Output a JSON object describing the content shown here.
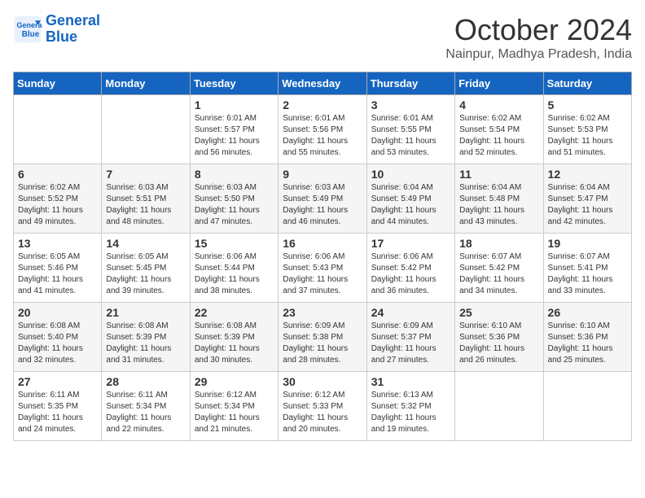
{
  "header": {
    "logo_line1": "General",
    "logo_line2": "Blue",
    "month": "October 2024",
    "location": "Nainpur, Madhya Pradesh, India"
  },
  "weekdays": [
    "Sunday",
    "Monday",
    "Tuesday",
    "Wednesday",
    "Thursday",
    "Friday",
    "Saturday"
  ],
  "weeks": [
    [
      {
        "day": "",
        "info": ""
      },
      {
        "day": "",
        "info": ""
      },
      {
        "day": "1",
        "info": "Sunrise: 6:01 AM\nSunset: 5:57 PM\nDaylight: 11 hours\nand 56 minutes."
      },
      {
        "day": "2",
        "info": "Sunrise: 6:01 AM\nSunset: 5:56 PM\nDaylight: 11 hours\nand 55 minutes."
      },
      {
        "day": "3",
        "info": "Sunrise: 6:01 AM\nSunset: 5:55 PM\nDaylight: 11 hours\nand 53 minutes."
      },
      {
        "day": "4",
        "info": "Sunrise: 6:02 AM\nSunset: 5:54 PM\nDaylight: 11 hours\nand 52 minutes."
      },
      {
        "day": "5",
        "info": "Sunrise: 6:02 AM\nSunset: 5:53 PM\nDaylight: 11 hours\nand 51 minutes."
      }
    ],
    [
      {
        "day": "6",
        "info": "Sunrise: 6:02 AM\nSunset: 5:52 PM\nDaylight: 11 hours\nand 49 minutes."
      },
      {
        "day": "7",
        "info": "Sunrise: 6:03 AM\nSunset: 5:51 PM\nDaylight: 11 hours\nand 48 minutes."
      },
      {
        "day": "8",
        "info": "Sunrise: 6:03 AM\nSunset: 5:50 PM\nDaylight: 11 hours\nand 47 minutes."
      },
      {
        "day": "9",
        "info": "Sunrise: 6:03 AM\nSunset: 5:49 PM\nDaylight: 11 hours\nand 46 minutes."
      },
      {
        "day": "10",
        "info": "Sunrise: 6:04 AM\nSunset: 5:49 PM\nDaylight: 11 hours\nand 44 minutes."
      },
      {
        "day": "11",
        "info": "Sunrise: 6:04 AM\nSunset: 5:48 PM\nDaylight: 11 hours\nand 43 minutes."
      },
      {
        "day": "12",
        "info": "Sunrise: 6:04 AM\nSunset: 5:47 PM\nDaylight: 11 hours\nand 42 minutes."
      }
    ],
    [
      {
        "day": "13",
        "info": "Sunrise: 6:05 AM\nSunset: 5:46 PM\nDaylight: 11 hours\nand 41 minutes."
      },
      {
        "day": "14",
        "info": "Sunrise: 6:05 AM\nSunset: 5:45 PM\nDaylight: 11 hours\nand 39 minutes."
      },
      {
        "day": "15",
        "info": "Sunrise: 6:06 AM\nSunset: 5:44 PM\nDaylight: 11 hours\nand 38 minutes."
      },
      {
        "day": "16",
        "info": "Sunrise: 6:06 AM\nSunset: 5:43 PM\nDaylight: 11 hours\nand 37 minutes."
      },
      {
        "day": "17",
        "info": "Sunrise: 6:06 AM\nSunset: 5:42 PM\nDaylight: 11 hours\nand 36 minutes."
      },
      {
        "day": "18",
        "info": "Sunrise: 6:07 AM\nSunset: 5:42 PM\nDaylight: 11 hours\nand 34 minutes."
      },
      {
        "day": "19",
        "info": "Sunrise: 6:07 AM\nSunset: 5:41 PM\nDaylight: 11 hours\nand 33 minutes."
      }
    ],
    [
      {
        "day": "20",
        "info": "Sunrise: 6:08 AM\nSunset: 5:40 PM\nDaylight: 11 hours\nand 32 minutes."
      },
      {
        "day": "21",
        "info": "Sunrise: 6:08 AM\nSunset: 5:39 PM\nDaylight: 11 hours\nand 31 minutes."
      },
      {
        "day": "22",
        "info": "Sunrise: 6:08 AM\nSunset: 5:39 PM\nDaylight: 11 hours\nand 30 minutes."
      },
      {
        "day": "23",
        "info": "Sunrise: 6:09 AM\nSunset: 5:38 PM\nDaylight: 11 hours\nand 28 minutes."
      },
      {
        "day": "24",
        "info": "Sunrise: 6:09 AM\nSunset: 5:37 PM\nDaylight: 11 hours\nand 27 minutes."
      },
      {
        "day": "25",
        "info": "Sunrise: 6:10 AM\nSunset: 5:36 PM\nDaylight: 11 hours\nand 26 minutes."
      },
      {
        "day": "26",
        "info": "Sunrise: 6:10 AM\nSunset: 5:36 PM\nDaylight: 11 hours\nand 25 minutes."
      }
    ],
    [
      {
        "day": "27",
        "info": "Sunrise: 6:11 AM\nSunset: 5:35 PM\nDaylight: 11 hours\nand 24 minutes."
      },
      {
        "day": "28",
        "info": "Sunrise: 6:11 AM\nSunset: 5:34 PM\nDaylight: 11 hours\nand 22 minutes."
      },
      {
        "day": "29",
        "info": "Sunrise: 6:12 AM\nSunset: 5:34 PM\nDaylight: 11 hours\nand 21 minutes."
      },
      {
        "day": "30",
        "info": "Sunrise: 6:12 AM\nSunset: 5:33 PM\nDaylight: 11 hours\nand 20 minutes."
      },
      {
        "day": "31",
        "info": "Sunrise: 6:13 AM\nSunset: 5:32 PM\nDaylight: 11 hours\nand 19 minutes."
      },
      {
        "day": "",
        "info": ""
      },
      {
        "day": "",
        "info": ""
      }
    ]
  ]
}
